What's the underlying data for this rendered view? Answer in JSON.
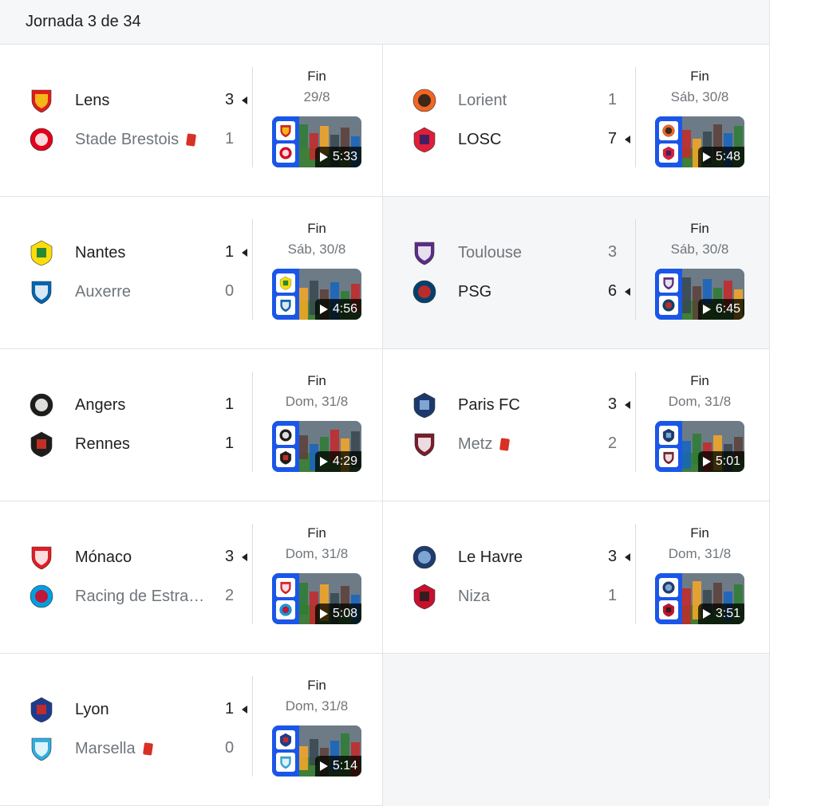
{
  "header": {
    "title": "Jornada 3 de 34"
  },
  "matches": [
    {
      "status": "Fin",
      "date": "29/8",
      "duration": "5:33",
      "home": {
        "name": "Lens",
        "score": "3",
        "winner": true,
        "red_card": false,
        "crest": "lens-crest",
        "color": "#e21b1b",
        "color2": "#f7d117"
      },
      "away": {
        "name": "Stade Brestois",
        "score": "1",
        "winner": false,
        "red_card": true,
        "crest": "brest-crest",
        "color": "#e2001a",
        "color2": "#ffffff"
      }
    },
    {
      "status": "Fin",
      "date": "Sáb, 30/8",
      "duration": "5:48",
      "home": {
        "name": "Lorient",
        "score": "1",
        "winner": false,
        "red_card": false,
        "crest": "lorient-crest",
        "color": "#f26522",
        "color2": "#1d1d1b"
      },
      "away": {
        "name": "LOSC",
        "score": "7",
        "winner": true,
        "red_card": false,
        "crest": "losc-crest",
        "color": "#e01e37",
        "color2": "#24216a"
      }
    },
    {
      "status": "Fin",
      "date": "Sáb, 30/8",
      "duration": "4:56",
      "home": {
        "name": "Nantes",
        "score": "1",
        "winner": true,
        "red_card": false,
        "crest": "nantes-crest",
        "color": "#fcdd09",
        "color2": "#007a3d"
      },
      "away": {
        "name": "Auxerre",
        "score": "0",
        "winner": false,
        "red_card": false,
        "crest": "auxerre-crest",
        "color": "#0066b3",
        "color2": "#ffffff"
      }
    },
    {
      "status": "Fin",
      "date": "Sáb, 30/8",
      "duration": "6:45",
      "home": {
        "name": "Toulouse",
        "score": "3",
        "winner": false,
        "red_card": false,
        "crest": "toulouse-crest",
        "color": "#5b2d86",
        "color2": "#ffffff"
      },
      "away": {
        "name": "PSG",
        "score": "6",
        "winner": true,
        "red_card": false,
        "crest": "psg-crest",
        "color": "#004170",
        "color2": "#da291c"
      }
    },
    {
      "status": "Fin",
      "date": "Dom, 31/8",
      "duration": "4:29",
      "home": {
        "name": "Angers",
        "score": "1",
        "winner": true,
        "red_card": false,
        "crest": "angers-crest",
        "color": "#1d1d1b",
        "color2": "#ffffff"
      },
      "away": {
        "name": "Rennes",
        "score": "1",
        "winner": true,
        "red_card": false,
        "crest": "rennes-crest",
        "color": "#1d1d1b",
        "color2": "#e13327"
      }
    },
    {
      "status": "Fin",
      "date": "Dom, 31/8",
      "duration": "5:01",
      "home": {
        "name": "Paris FC",
        "score": "3",
        "winner": true,
        "red_card": false,
        "crest": "paris-fc-crest",
        "color": "#1b3a6b",
        "color2": "#8fb8e6"
      },
      "away": {
        "name": "Metz",
        "score": "2",
        "winner": false,
        "red_card": true,
        "crest": "metz-crest",
        "color": "#7a1c2c",
        "color2": "#ffffff"
      }
    },
    {
      "status": "Fin",
      "date": "Dom, 31/8",
      "duration": "5:08",
      "home": {
        "name": "Mónaco",
        "score": "3",
        "winner": true,
        "red_card": false,
        "crest": "monaco-crest",
        "color": "#e51b24",
        "color2": "#ffffff"
      },
      "away": {
        "name": "Racing de Estrasburgo",
        "score": "2",
        "winner": false,
        "red_card": false,
        "crest": "strasbourg-crest",
        "color": "#009fe3",
        "color2": "#e2001a"
      }
    },
    {
      "status": "Fin",
      "date": "Dom, 31/8",
      "duration": "3:51",
      "home": {
        "name": "Le Havre",
        "score": "3",
        "winner": true,
        "red_card": false,
        "crest": "le-havre-crest",
        "color": "#1e3c6e",
        "color2": "#8fb8e6"
      },
      "away": {
        "name": "Niza",
        "score": "1",
        "winner": false,
        "red_card": false,
        "crest": "nice-crest",
        "color": "#c8102e",
        "color2": "#1d1d1b"
      }
    },
    {
      "status": "Fin",
      "date": "Dom, 31/8",
      "duration": "5:14",
      "home": {
        "name": "Lyon",
        "score": "1",
        "winner": true,
        "red_card": false,
        "crest": "lyon-crest",
        "color": "#1d3c8f",
        "color2": "#da291c"
      },
      "away": {
        "name": "Marsella",
        "score": "0",
        "winner": false,
        "red_card": true,
        "crest": "marseille-crest",
        "color": "#2faee0",
        "color2": "#ffffff"
      }
    }
  ]
}
